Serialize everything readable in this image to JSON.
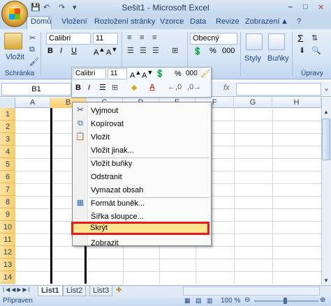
{
  "window": {
    "title": "Sešit1 - Microsoft Excel"
  },
  "qat": {
    "save": "💾",
    "undo": "↶",
    "redo": "↷",
    "more": "▾"
  },
  "window_controls": {
    "min": "–",
    "max": "□",
    "close": "✕"
  },
  "tabs": [
    "Domů",
    "Vložení",
    "Rozložení stránky",
    "Vzorce",
    "Data",
    "Revize",
    "Zobrazení"
  ],
  "ribbon": {
    "paste_label": "Vložit",
    "clipboard_label": "Schránka",
    "font_name": "Calibri",
    "font_size": "11",
    "number_format": "Obecný",
    "styles_label": "Styly",
    "cells_label": "Buňky",
    "editing_label": "Úpravy",
    "percent": "%",
    "thousands": "000",
    "sigma": "Σ",
    "help": "?"
  },
  "formula": {
    "name_box": "B1"
  },
  "columns": [
    "A",
    "B",
    "C",
    "D",
    "E",
    "F",
    "G",
    "H"
  ],
  "rows": [
    "1",
    "2",
    "3",
    "4",
    "5",
    "6",
    "7",
    "8",
    "9",
    "10",
    "11",
    "12",
    "13",
    "14"
  ],
  "mini_toolbar": {
    "font_name": "Calibri",
    "font_size": "11",
    "percent": "%",
    "thousands": "000"
  },
  "context_menu": {
    "items": [
      "Vyjmout",
      "Kopírovat",
      "Vložit",
      "Vložit jinak...",
      "Vložit buňky",
      "Odstranit",
      "Vymazat obsah",
      "Formát buněk...",
      "Šířka sloupce...",
      "Skrýt",
      "Zobrazit"
    ]
  },
  "sheets": [
    "List1",
    "List2",
    "List3"
  ],
  "status": {
    "ready": "Připraven",
    "zoom": "100 %"
  }
}
